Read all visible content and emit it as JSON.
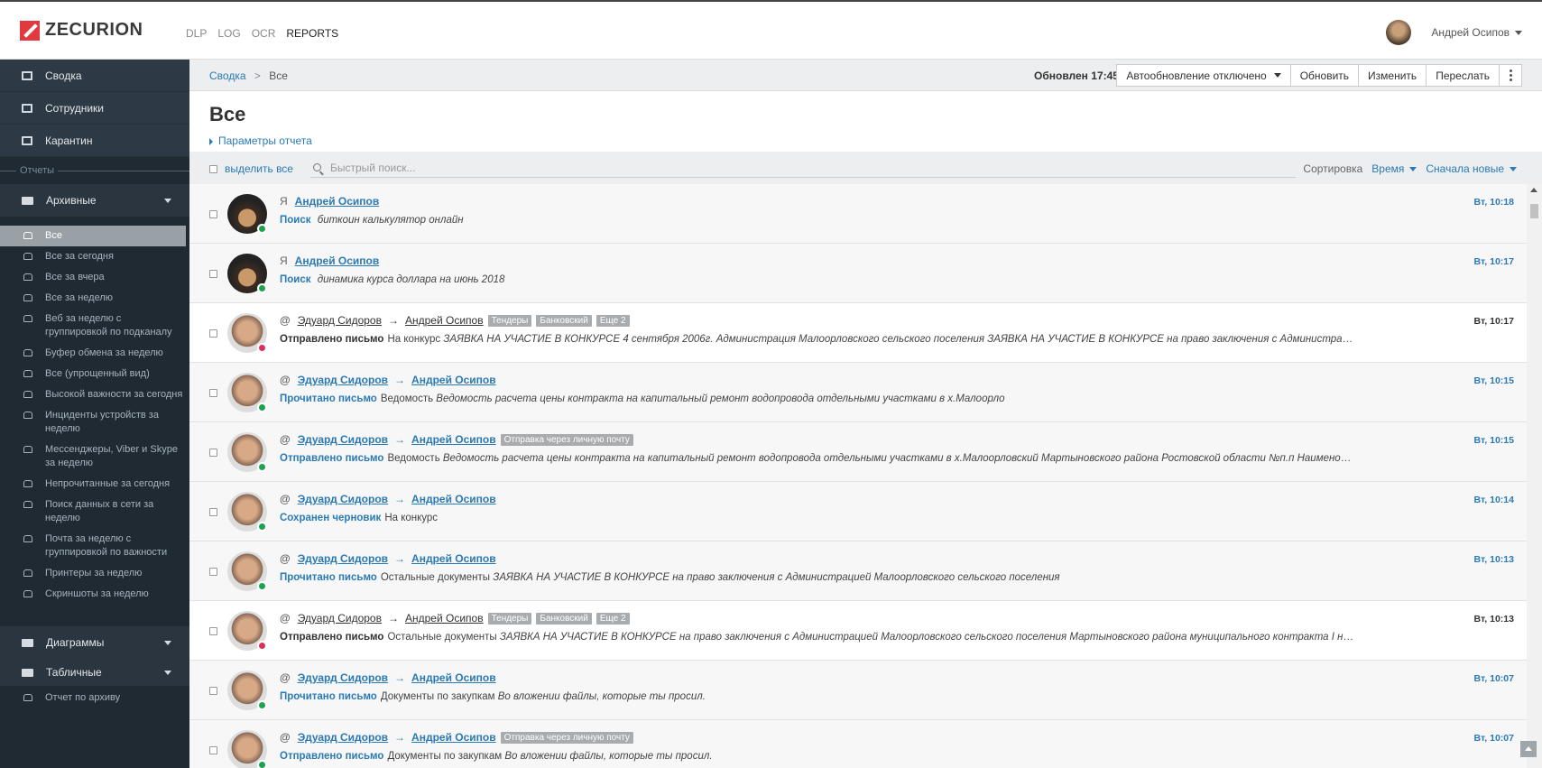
{
  "app": {
    "logo_text": "ZECURION",
    "brand_color": "#e03a3e",
    "accent_color": "#2a7ab5"
  },
  "topnav": [
    {
      "label": "DLP",
      "active": false
    },
    {
      "label": "LOG",
      "active": false
    },
    {
      "label": "OCR",
      "active": false
    },
    {
      "label": "REPORTS",
      "active": true
    }
  ],
  "user": {
    "name": "Андрей Осипов"
  },
  "sidebar": {
    "top": [
      {
        "label": "Сводка",
        "icon": "laptop-icon"
      },
      {
        "label": "Сотрудники",
        "icon": "user-icon"
      },
      {
        "label": "Карантин",
        "icon": "inbox-icon"
      }
    ],
    "section_label": "Отчеты",
    "archive_folder": "Архивные",
    "archive_items": [
      "Все",
      "Все за сегодня",
      "Все за вчера",
      "Все за неделю",
      "Веб за неделю с группировкой по подканалу",
      "Буфер обмена за неделю",
      "Все (упрощенный вид)",
      "Высокой важности за сегодня",
      "Инциденты устройств за неделю",
      "Мессенджеры, Viber и Skype за неделю",
      "Непрочитанные за сегодня",
      "Поиск данных в сети за неделю",
      "Почта за неделю с группировкой по важности",
      "Принтеры за неделю",
      "Скриншоты за неделю"
    ],
    "folders_bottom": [
      "Диаграммы",
      "Табличные"
    ],
    "partial_item": "Отчет по архиву"
  },
  "main": {
    "breadcrumb": {
      "root": "Сводка",
      "sep": ">",
      "current": "Все"
    },
    "updated": "Обновлен 17:45",
    "buttons": {
      "autoupdate": "Автообновление отключено",
      "refresh": "Обновить",
      "edit": "Изменить",
      "forward": "Переслать"
    },
    "title": "Все",
    "params_link": "Параметры отчета",
    "select_all": "выделить все",
    "search_placeholder": "Быстрый поиск...",
    "sort": {
      "label": "Сортировка",
      "field": "Время",
      "order": "Сначала новые"
    }
  },
  "events": [
    {
      "kind": "Я",
      "from": "Андрей Осипов",
      "to": "",
      "tags": [],
      "action": "Поиск",
      "text": "",
      "italic": "биткоин калькулятор онлайн",
      "time": "Вт, 10:18",
      "unread": false,
      "avatar": "a1",
      "status": "online"
    },
    {
      "kind": "Я",
      "from": "Андрей Осипов",
      "to": "",
      "tags": [],
      "action": "Поиск",
      "text": "",
      "italic": "динамика курса доллара на июнь 2018",
      "time": "Вт, 10:17",
      "unread": false,
      "avatar": "a1",
      "status": "online"
    },
    {
      "kind": "@",
      "from": "Эдуард Сидоров",
      "to": "Андрей Осипов",
      "tags": [
        "Тендеры",
        "Банковский",
        "Еще 2"
      ],
      "action": "Отправлено письмо",
      "text": "На конкурс",
      "italic": "ЗАЯВКА НА УЧАСТИЕ В КОНКУРСЕ   4 сентября 2006г.   Администрация  Малоорловского сельского поселения      ЗАЯВКА НА УЧАСТИЕ В КОНКУРСЕ   на право заключения с Администрацией Малоорловского сельского поселения",
      "time": "Вт, 10:17",
      "unread": true,
      "avatar": "a2",
      "status": "offline"
    },
    {
      "kind": "@",
      "from": "Эдуард Сидоров",
      "to": "Андрей Осипов",
      "tags": [],
      "action": "Прочитано письмо",
      "text": "Ведомость",
      "italic": "Ведомость расчета цены контракта на капитальный ремонт водопровода отдельными участками в х.Малоорло",
      "time": "Вт, 10:15",
      "unread": false,
      "avatar": "a2",
      "status": "online"
    },
    {
      "kind": "@",
      "from": "Эдуард Сидоров",
      "to": "Андрей Осипов",
      "tags": [
        "Отправка через личную почту"
      ],
      "action": "Отправлено письмо",
      "text": "Ведомость",
      "italic": "      Ведомость расчета цены контракта на капитальный ремонт водопровода отдельными участками в х.Малоорловский Мартыновского района Ростовской области   №п.п Наименование видов работ",
      "time": "Вт, 10:15",
      "unread": false,
      "avatar": "a2",
      "status": "online"
    },
    {
      "kind": "@",
      "from": "Эдуард Сидоров",
      "to": "Андрей Осипов",
      "tags": [],
      "action": "Сохранен черновик",
      "text": "На конкурс",
      "italic": "",
      "time": "Вт, 10:14",
      "unread": false,
      "avatar": "a2",
      "status": "online"
    },
    {
      "kind": "@",
      "from": "Эдуард Сидоров",
      "to": "Андрей Осипов",
      "tags": [],
      "action": "Прочитано письмо",
      "text": "Остальные документы",
      "italic": "ЗАЯВКА НА УЧАСТИЕ В КОНКУРСЕ на право заключения с Администрацией Малоорловского сельского поселения",
      "time": "Вт, 10:13",
      "unread": false,
      "avatar": "a2",
      "status": "online"
    },
    {
      "kind": "@",
      "from": "Эдуард Сидоров",
      "to": "Андрей Осипов",
      "tags": [
        "Тендеры",
        "Банковский",
        "Еще 2"
      ],
      "action": "Отправлено письмо",
      "text": "Остальные документы",
      "italic": "ЗАЯВКА НА УЧАСТИЕ В КОНКУРСЕ   на право заключения с Администрацией Малоорловского  сельского поселения Мартыновского района муниципального контракта I на закупку работ по ремонту",
      "time": "Вт, 10:13",
      "unread": true,
      "avatar": "a2",
      "status": "offline"
    },
    {
      "kind": "@",
      "from": "Эдуард Сидоров",
      "to": "Андрей Осипов",
      "tags": [],
      "action": "Прочитано письмо",
      "text": "Документы по закупкам",
      "italic": "Во вложении файлы, которые ты просил.",
      "time": "Вт, 10:07",
      "unread": false,
      "avatar": "a2",
      "status": "online"
    },
    {
      "kind": "@",
      "from": "Эдуард Сидоров",
      "to": "Андрей Осипов",
      "tags": [
        "Отправка через личную почту"
      ],
      "action": "Отправлено письмо",
      "text": "Документы по закупкам",
      "italic": "Во вложении файлы, которые ты просил.",
      "time": "Вт, 10:07",
      "unread": false,
      "avatar": "a2",
      "status": "online"
    }
  ]
}
